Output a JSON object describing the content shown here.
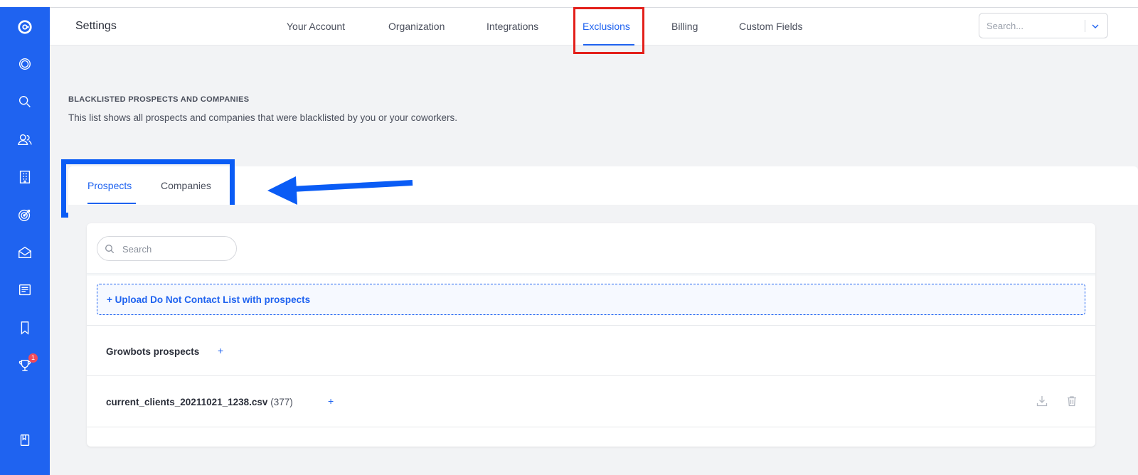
{
  "header": {
    "title": "Settings",
    "tabs": [
      {
        "label": "Your Account"
      },
      {
        "label": "Organization"
      },
      {
        "label": "Integrations"
      },
      {
        "label": "Exclusions",
        "active": true
      },
      {
        "label": "Billing"
      },
      {
        "label": "Custom Fields"
      }
    ],
    "search_placeholder": "Search..."
  },
  "sidebar": {
    "items": [
      {
        "icon": "logo-icon"
      },
      {
        "icon": "dashboard-icon"
      },
      {
        "icon": "search-icon"
      },
      {
        "icon": "people-icon"
      },
      {
        "icon": "building-icon"
      },
      {
        "icon": "target-icon"
      },
      {
        "icon": "mail-icon"
      },
      {
        "icon": "templates-icon"
      },
      {
        "icon": "bookmark-icon"
      },
      {
        "icon": "trophy-icon",
        "badge": "1"
      },
      {
        "icon": "book-icon"
      }
    ]
  },
  "section": {
    "heading": "BLACKLISTED PROSPECTS AND COMPANIES",
    "description": "This list shows all prospects and companies that were blacklisted by you or your coworkers."
  },
  "subtabs": [
    {
      "label": "Prospects",
      "active": true
    },
    {
      "label": "Companies"
    }
  ],
  "list": {
    "search_placeholder": "Search",
    "upload_label": "+ Upload Do Not Contact List with prospects",
    "rows": [
      {
        "name": "Growbots prospects",
        "count": "",
        "add": "+"
      },
      {
        "name": "current_clients_20211021_1238.csv",
        "count": "(377)",
        "add": "+"
      }
    ]
  },
  "colors": {
    "brand": "#1f63f0",
    "annotation_red": "#e3201b",
    "annotation_blue": "#0a5cf5",
    "badge": "#f04a5b"
  }
}
